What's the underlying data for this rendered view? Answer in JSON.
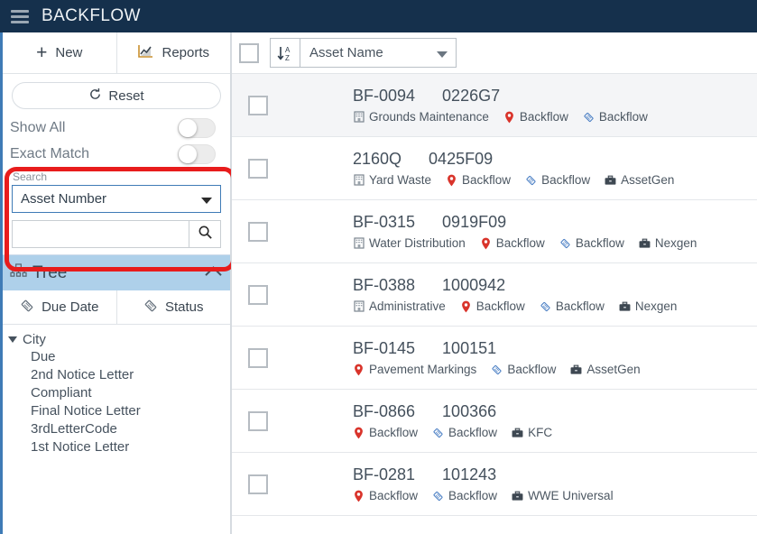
{
  "header": {
    "title": "BACKFLOW",
    "menu_icon": "hamburger-icon"
  },
  "sidebar": {
    "toolbar": [
      {
        "label": "New",
        "icon": "plus-icon"
      },
      {
        "label": "Reports",
        "icon": "chart-report-icon"
      }
    ],
    "reset_label": "Reset",
    "reset_icon": "refresh-icon",
    "toggles": [
      {
        "label": "Show All",
        "state": "off"
      },
      {
        "label": "Exact Match",
        "state": "off"
      }
    ],
    "search": {
      "caption": "Search",
      "field_selected": "Asset Number",
      "field_options": [
        "Asset Number"
      ],
      "input_value": "",
      "input_placeholder": "",
      "button_icon": "magnifier-icon",
      "dropdown_icon": "caret-down-icon",
      "highlighted": true,
      "highlight_color": "#e81c1c"
    },
    "tree": {
      "title": "Tree",
      "icon": "tree-hierarchy-icon",
      "collapse_icon": "chevron-up-icon",
      "tabs": [
        {
          "label": "Due Date",
          "icon": "diamond-tag-icon"
        },
        {
          "label": "Status",
          "icon": "diamond-tag-icon"
        }
      ],
      "root": {
        "label": "City",
        "expand_icon": "triangle-down-icon"
      },
      "children": [
        "Due",
        "2nd Notice Letter",
        "Compliant",
        "Final Notice Letter",
        "3rdLetterCode",
        "1st Notice Letter"
      ]
    }
  },
  "list": {
    "toolbar": {
      "select_all_checked": false,
      "sort_icon": "sort-az-descending-icon",
      "sort_field": "Asset Name",
      "sort_dropdown_icon": "caret-down-icon"
    },
    "rows": [
      {
        "id": "BF-0094",
        "code": "0226G7",
        "checked": false,
        "meta": [
          {
            "icon": "building-icon",
            "label": "Grounds Maintenance"
          },
          {
            "icon": "map-pin-icon",
            "label": "Backflow"
          },
          {
            "icon": "diamond-tag-icon",
            "label": "Backflow"
          }
        ]
      },
      {
        "id": "2160Q",
        "code": "0425F09",
        "checked": false,
        "meta": [
          {
            "icon": "building-icon",
            "label": "Yard Waste"
          },
          {
            "icon": "map-pin-icon",
            "label": "Backflow"
          },
          {
            "icon": "diamond-tag-icon",
            "label": "Backflow"
          },
          {
            "icon": "briefcase-icon",
            "label": "AssetGen"
          }
        ]
      },
      {
        "id": "BF-0315",
        "code": "0919F09",
        "checked": false,
        "meta": [
          {
            "icon": "building-icon",
            "label": "Water Distribution"
          },
          {
            "icon": "map-pin-icon",
            "label": "Backflow"
          },
          {
            "icon": "diamond-tag-icon",
            "label": "Backflow"
          },
          {
            "icon": "briefcase-icon",
            "label": "Nexgen"
          }
        ]
      },
      {
        "id": "BF-0388",
        "code": "1000942",
        "checked": false,
        "meta": [
          {
            "icon": "building-icon",
            "label": "Administrative"
          },
          {
            "icon": "map-pin-icon",
            "label": "Backflow"
          },
          {
            "icon": "diamond-tag-icon",
            "label": "Backflow"
          },
          {
            "icon": "briefcase-icon",
            "label": "Nexgen"
          }
        ]
      },
      {
        "id": "BF-0145",
        "code": "100151",
        "checked": false,
        "meta": [
          {
            "icon": "map-pin-icon",
            "label": "Pavement Markings"
          },
          {
            "icon": "diamond-tag-icon",
            "label": "Backflow"
          },
          {
            "icon": "briefcase-icon",
            "label": "AssetGen"
          }
        ]
      },
      {
        "id": "BF-0866",
        "code": "100366",
        "checked": false,
        "meta": [
          {
            "icon": "map-pin-icon",
            "label": "Backflow"
          },
          {
            "icon": "diamond-tag-icon",
            "label": "Backflow"
          },
          {
            "icon": "briefcase-icon",
            "label": "KFC"
          }
        ]
      },
      {
        "id": "BF-0281",
        "code": "101243",
        "checked": false,
        "meta": [
          {
            "icon": "map-pin-icon",
            "label": "Backflow"
          },
          {
            "icon": "diamond-tag-icon",
            "label": "Backflow"
          },
          {
            "icon": "briefcase-icon",
            "label": "WWE Universal"
          }
        ]
      }
    ]
  },
  "colors": {
    "header_bg": "#15304c",
    "accent_blue": "#3f7bb6",
    "tree_header_bg": "#aed0ea",
    "annotation_red": "#e81c1c",
    "pin_red": "#d9342b",
    "alt_row_bg": "#f4f5f7"
  }
}
